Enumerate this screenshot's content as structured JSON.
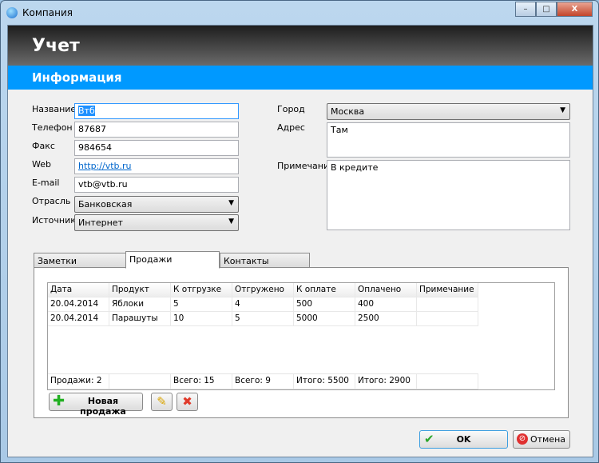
{
  "window": {
    "title": "Компания",
    "min": "–",
    "max": "□",
    "close": "X"
  },
  "header": {
    "title": "Учет",
    "subtitle": "Информация"
  },
  "form": {
    "name_label": "Название",
    "name_value": "Втб",
    "phone_label": "Телефон",
    "phone_value": "87687",
    "fax_label": "Факс",
    "fax_value": "984654",
    "web_label": "Web",
    "web_value": "http://vtb.ru",
    "email_label": "E-mail",
    "email_value": "vtb@vtb.ru",
    "industry_label": "Отрасль",
    "industry_value": "Банковская",
    "source_label": "Источник",
    "source_value": "Интернет",
    "city_label": "Город",
    "city_value": "Москва",
    "address_label": "Адрес",
    "address_value": "Там",
    "note_label": "Примечание",
    "note_value": "В кредите"
  },
  "tabs": [
    {
      "label": "Заметки"
    },
    {
      "label": "Продажи"
    },
    {
      "label": "Контакты"
    }
  ],
  "sales": {
    "columns": [
      "Дата",
      "Продукт",
      "К отгрузке",
      "Отгружено",
      "К оплате",
      "Оплачено",
      "Примечание"
    ],
    "rows": [
      [
        "20.04.2014",
        "Яблоки",
        "5",
        "4",
        "500",
        "400",
        ""
      ],
      [
        "20.04.2014",
        "Парашуты",
        "10",
        "5",
        "5000",
        "2500",
        ""
      ]
    ],
    "footer": [
      "Продажи: 2",
      "",
      "Всего: 15",
      "Всего: 9",
      "Итого: 5500",
      "Итого: 2900",
      ""
    ],
    "new_label": "Новая продажа"
  },
  "dialog": {
    "ok": "OK",
    "cancel": "Отмена"
  }
}
